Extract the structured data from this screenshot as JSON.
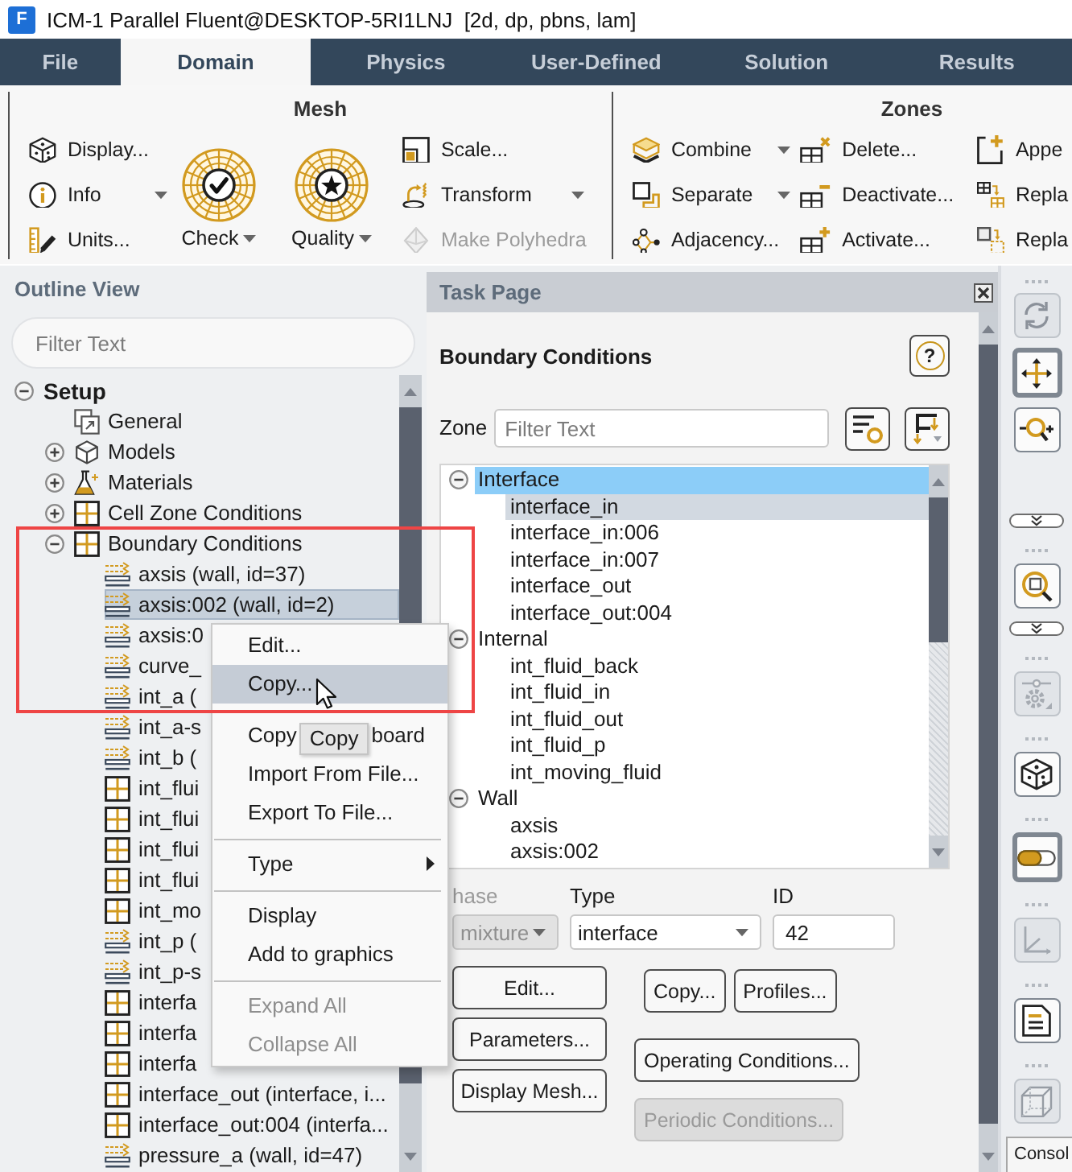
{
  "window": {
    "logo": "F",
    "title": "ICM-1 Parallel Fluent@DESKTOP-5RI1LNJ  [2d, dp, pbns, lam]"
  },
  "tabs": [
    {
      "label": "File",
      "selected": false
    },
    {
      "label": "Domain",
      "selected": true
    },
    {
      "label": "Physics",
      "selected": false
    },
    {
      "label": "User-Defined",
      "selected": false
    },
    {
      "label": "Solution",
      "selected": false
    },
    {
      "label": "Results",
      "selected": false
    }
  ],
  "ribbon": {
    "groups": [
      {
        "title": "Mesh",
        "items": [
          {
            "kind": "small",
            "label": "Display...",
            "dropdown": false,
            "disabled": false
          },
          {
            "kind": "small",
            "label": "Info",
            "dropdown": true,
            "disabled": false
          },
          {
            "kind": "small",
            "label": "Units...",
            "dropdown": false,
            "disabled": false
          },
          {
            "kind": "large",
            "label": "Check",
            "dropdown": true,
            "disabled": false
          },
          {
            "kind": "large",
            "label": "Quality",
            "dropdown": true,
            "disabled": false
          },
          {
            "kind": "small",
            "label": "Scale...",
            "dropdown": false,
            "disabled": false
          },
          {
            "kind": "small",
            "label": "Transform",
            "dropdown": true,
            "disabled": false
          },
          {
            "kind": "small",
            "label": "Make Polyhedra",
            "dropdown": false,
            "disabled": true
          }
        ]
      },
      {
        "title": "Zones",
        "items": [
          {
            "kind": "small",
            "label": "Combine",
            "dropdown": true,
            "disabled": false
          },
          {
            "kind": "small",
            "label": "Separate",
            "dropdown": true,
            "disabled": false
          },
          {
            "kind": "small",
            "label": "Adjacency...",
            "dropdown": false,
            "disabled": false
          },
          {
            "kind": "small",
            "label": "Delete...",
            "dropdown": false,
            "disabled": false
          },
          {
            "kind": "small",
            "label": "Deactivate...",
            "dropdown": false,
            "disabled": false
          },
          {
            "kind": "small",
            "label": "Activate...",
            "dropdown": false,
            "disabled": false
          },
          {
            "kind": "small",
            "label": "Appe",
            "dropdown": false,
            "disabled": false
          },
          {
            "kind": "small",
            "label": "Repla",
            "dropdown": false,
            "disabled": false
          },
          {
            "kind": "small",
            "label": "Repla",
            "dropdown": false,
            "disabled": false
          }
        ]
      }
    ]
  },
  "outline": {
    "title": "Outline View",
    "filter": {
      "placeholder": "Filter Text"
    },
    "tree": [
      {
        "kind": "root",
        "label": "Setup",
        "expanded": true,
        "selected": false,
        "children": [
          {
            "kind": "item",
            "label": "General",
            "selected": false
          },
          {
            "kind": "folder",
            "label": "Models",
            "expanded": false,
            "selected": false
          },
          {
            "kind": "folder",
            "label": "Materials",
            "expanded": false,
            "selected": false
          },
          {
            "kind": "folder",
            "label": "Cell Zone Conditions",
            "expanded": false,
            "selected": false
          },
          {
            "kind": "folder",
            "label": "Boundary Conditions",
            "expanded": true,
            "selected": false,
            "children": [
              {
                "kind": "wall",
                "label": "axsis (wall, id=37)",
                "selected": false
              },
              {
                "kind": "wall",
                "label": "axsis:002 (wall, id=2)",
                "selected": true
              },
              {
                "kind": "wall",
                "label": "axsis:0",
                "selected": false
              },
              {
                "kind": "wall",
                "label": "curve_",
                "selected": false
              },
              {
                "kind": "wall",
                "label": "int_a (",
                "selected": false
              },
              {
                "kind": "wall",
                "label": "int_a-s",
                "selected": false
              },
              {
                "kind": "wall",
                "label": "int_b (",
                "selected": false
              },
              {
                "kind": "interior",
                "label": "int_flui",
                "selected": false
              },
              {
                "kind": "interior",
                "label": "int_flui",
                "selected": false
              },
              {
                "kind": "interior",
                "label": "int_flui",
                "selected": false
              },
              {
                "kind": "interior",
                "label": "int_flui",
                "selected": false
              },
              {
                "kind": "interior",
                "label": "int_mo",
                "selected": false
              },
              {
                "kind": "wall",
                "label": "int_p (",
                "selected": false
              },
              {
                "kind": "wall",
                "label": "int_p-s",
                "selected": false
              },
              {
                "kind": "interior",
                "label": "interfa",
                "selected": false
              },
              {
                "kind": "interior",
                "label": "interfa",
                "selected": false
              },
              {
                "kind": "interior",
                "label": "interfa",
                "selected": false
              },
              {
                "kind": "interior",
                "label": "interface_out (interface, i...",
                "selected": false
              },
              {
                "kind": "interior",
                "label": "interface_out:004 (interfa...",
                "selected": false
              },
              {
                "kind": "wall",
                "label": "pressure_a (wall, id=47)",
                "selected": false
              }
            ]
          }
        ]
      }
    ]
  },
  "task_page": {
    "title": "Task Page",
    "heading": "Boundary Conditions",
    "help": "?",
    "zone": {
      "label": "Zone",
      "placeholder": "Filter Text"
    },
    "zones": [
      {
        "label": "Interface",
        "expanded": true,
        "selected": true,
        "children": [
          {
            "label": "interface_in",
            "selected": true
          },
          {
            "label": "interface_in:006",
            "selected": false
          },
          {
            "label": "interface_in:007",
            "selected": false
          },
          {
            "label": "interface_out",
            "selected": false
          },
          {
            "label": "interface_out:004",
            "selected": false
          }
        ]
      },
      {
        "label": "Internal",
        "expanded": true,
        "selected": false,
        "children": [
          {
            "label": "int_fluid_back",
            "selected": false
          },
          {
            "label": "int_fluid_in",
            "selected": false
          },
          {
            "label": "int_fluid_out",
            "selected": false
          },
          {
            "label": "int_fluid_p",
            "selected": false
          },
          {
            "label": "int_moving_fluid",
            "selected": false
          }
        ]
      },
      {
        "label": "Wall",
        "expanded": true,
        "selected": false,
        "children": [
          {
            "label": "axsis",
            "selected": false
          },
          {
            "label": "axsis:002",
            "selected": false
          }
        ]
      }
    ],
    "fields": [
      {
        "kind": "dropdown",
        "label": "hase",
        "value": "mixture",
        "disabled": true
      },
      {
        "kind": "dropdown",
        "label": "Type",
        "value": "interface",
        "disabled": false
      },
      {
        "kind": "text",
        "label": "ID",
        "value": "42",
        "disabled": false
      }
    ],
    "buttons": {
      "left": [
        {
          "label": "Edit...",
          "disabled": false
        },
        {
          "label": "Parameters...",
          "disabled": false
        },
        {
          "label": "Display Mesh...",
          "disabled": false
        }
      ],
      "right": [
        [
          {
            "label": "Copy...",
            "disabled": false
          },
          {
            "label": "Profiles...",
            "disabled": false
          }
        ],
        [
          {
            "label": "Operating Conditions...",
            "disabled": false
          }
        ],
        [
          {
            "label": "Periodic Conditions...",
            "disabled": true
          }
        ]
      ]
    }
  },
  "context_menu": {
    "items": [
      {
        "kind": "item",
        "label": "Edit...",
        "selected": false,
        "disabled": false
      },
      {
        "kind": "item",
        "label": "Copy...",
        "selected": true,
        "disabled": false
      },
      {
        "kind": "separator"
      },
      {
        "kind": "covered",
        "label": "Copy",
        "tooltip": "Copy",
        "label_end": "board",
        "selected": false,
        "disabled": false
      },
      {
        "kind": "item",
        "label": "Import From File...",
        "selected": false,
        "disabled": false
      },
      {
        "kind": "item",
        "label": "Export To File...",
        "selected": false,
        "disabled": false
      },
      {
        "kind": "separator"
      },
      {
        "kind": "submenu",
        "label": "Type",
        "selected": false,
        "disabled": false
      },
      {
        "kind": "separator"
      },
      {
        "kind": "item",
        "label": "Display",
        "selected": false,
        "disabled": false
      },
      {
        "kind": "item",
        "label": "Add to graphics",
        "selected": false,
        "disabled": false
      },
      {
        "kind": "separator"
      },
      {
        "kind": "item",
        "label": "Expand All",
        "selected": false,
        "disabled": true
      },
      {
        "kind": "item",
        "label": "Collapse All",
        "selected": false,
        "disabled": true
      }
    ]
  },
  "view_toolbar": {
    "items": [
      {
        "kind": "grip"
      },
      {
        "kind": "tool",
        "selected": false,
        "disabled": true
      },
      {
        "kind": "tool",
        "selected": true,
        "disabled": false
      },
      {
        "kind": "tool",
        "selected": false,
        "disabled": false
      },
      {
        "kind": "handle"
      },
      {
        "kind": "grip"
      },
      {
        "kind": "tool",
        "selected": false,
        "disabled": false
      },
      {
        "kind": "handle"
      },
      {
        "kind": "grip"
      },
      {
        "kind": "tool",
        "selected": false,
        "disabled": true
      },
      {
        "kind": "grip"
      },
      {
        "kind": "tool",
        "selected": false,
        "disabled": false
      },
      {
        "kind": "grip"
      },
      {
        "kind": "tool",
        "selected": true,
        "disabled": false
      },
      {
        "kind": "grip"
      },
      {
        "kind": "tool",
        "selected": false,
        "disabled": true
      },
      {
        "kind": "grip"
      },
      {
        "kind": "tool",
        "selected": false,
        "disabled": false
      },
      {
        "kind": "grip"
      },
      {
        "kind": "tool",
        "selected": false,
        "disabled": true
      }
    ],
    "console_tab": "Consol"
  }
}
